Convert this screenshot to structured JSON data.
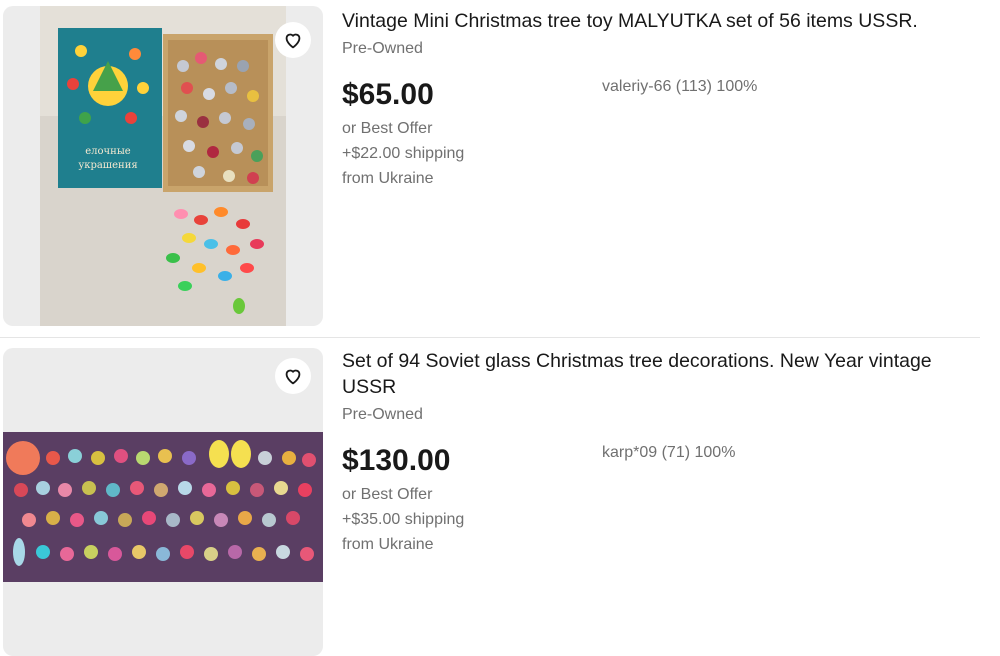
{
  "listings": [
    {
      "title": "Vintage Mini Christmas tree toy MALYUTKA set of 56 items USSR.",
      "condition": "Pre-Owned",
      "price": "$65.00",
      "seller": "valeriy-66 (113) 100%",
      "offer": "or Best Offer",
      "shipping": "+$22.00 shipping",
      "location": "from Ukraine",
      "box_text": [
        "елочные",
        "украшения"
      ]
    },
    {
      "title": "Set of 94 Soviet glass Christmas tree decorations. New Year vintage USSR",
      "condition": "Pre-Owned",
      "price": "$130.00",
      "seller": "karp*09 (71) 100%",
      "offer": "or Best Offer",
      "shipping": "+$35.00 shipping",
      "location": "from Ukraine"
    }
  ],
  "icons": {
    "watch": "heart-icon"
  }
}
